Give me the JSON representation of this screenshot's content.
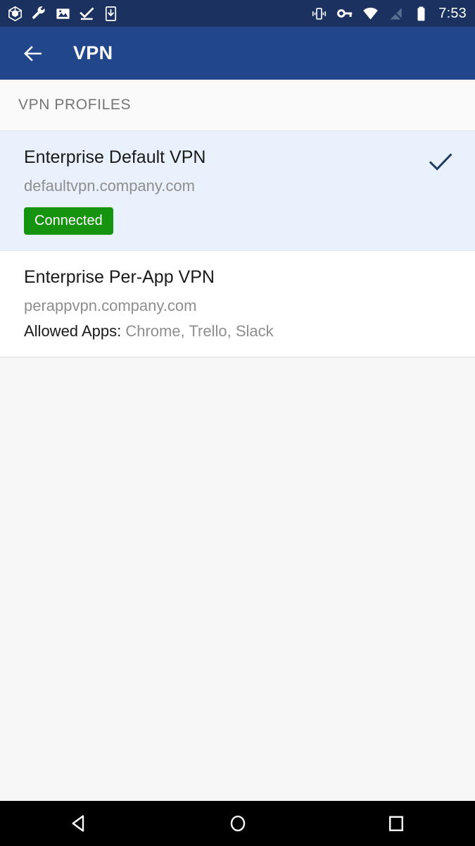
{
  "status_bar": {
    "left_icons": [
      {
        "name": "cube-3d-icon"
      },
      {
        "name": "wrench-icon"
      },
      {
        "name": "image-icon"
      },
      {
        "name": "check-underline-icon"
      },
      {
        "name": "app-install-download-icon"
      }
    ],
    "right_icons": [
      {
        "name": "vibrate-icon"
      },
      {
        "name": "vpn-key-icon"
      },
      {
        "name": "wifi-icon"
      },
      {
        "name": "no-signal-icon"
      },
      {
        "name": "battery-full-icon"
      }
    ],
    "time": "7:53",
    "background_color": "#1b3260"
  },
  "app_bar": {
    "back_label": "back-arrow",
    "title": "VPN",
    "background_color": "#21478a"
  },
  "section": {
    "header": "VPN PROFILES"
  },
  "profiles": [
    {
      "title": "Enterprise Default VPN",
      "host": "defaultvpn.company.com",
      "badge": "Connected",
      "badge_color": "#16930f",
      "selected": true,
      "checkmark": true
    },
    {
      "title": "Enterprise Per-App VPN",
      "host": "perappvpn.company.com",
      "apps_label": "Allowed Apps:",
      "apps_value": "Chrome, Trello, Slack",
      "selected": false,
      "checkmark": false
    }
  ],
  "nav_bar": {
    "back": "nav-back",
    "home": "nav-home",
    "recents": "nav-recents"
  }
}
